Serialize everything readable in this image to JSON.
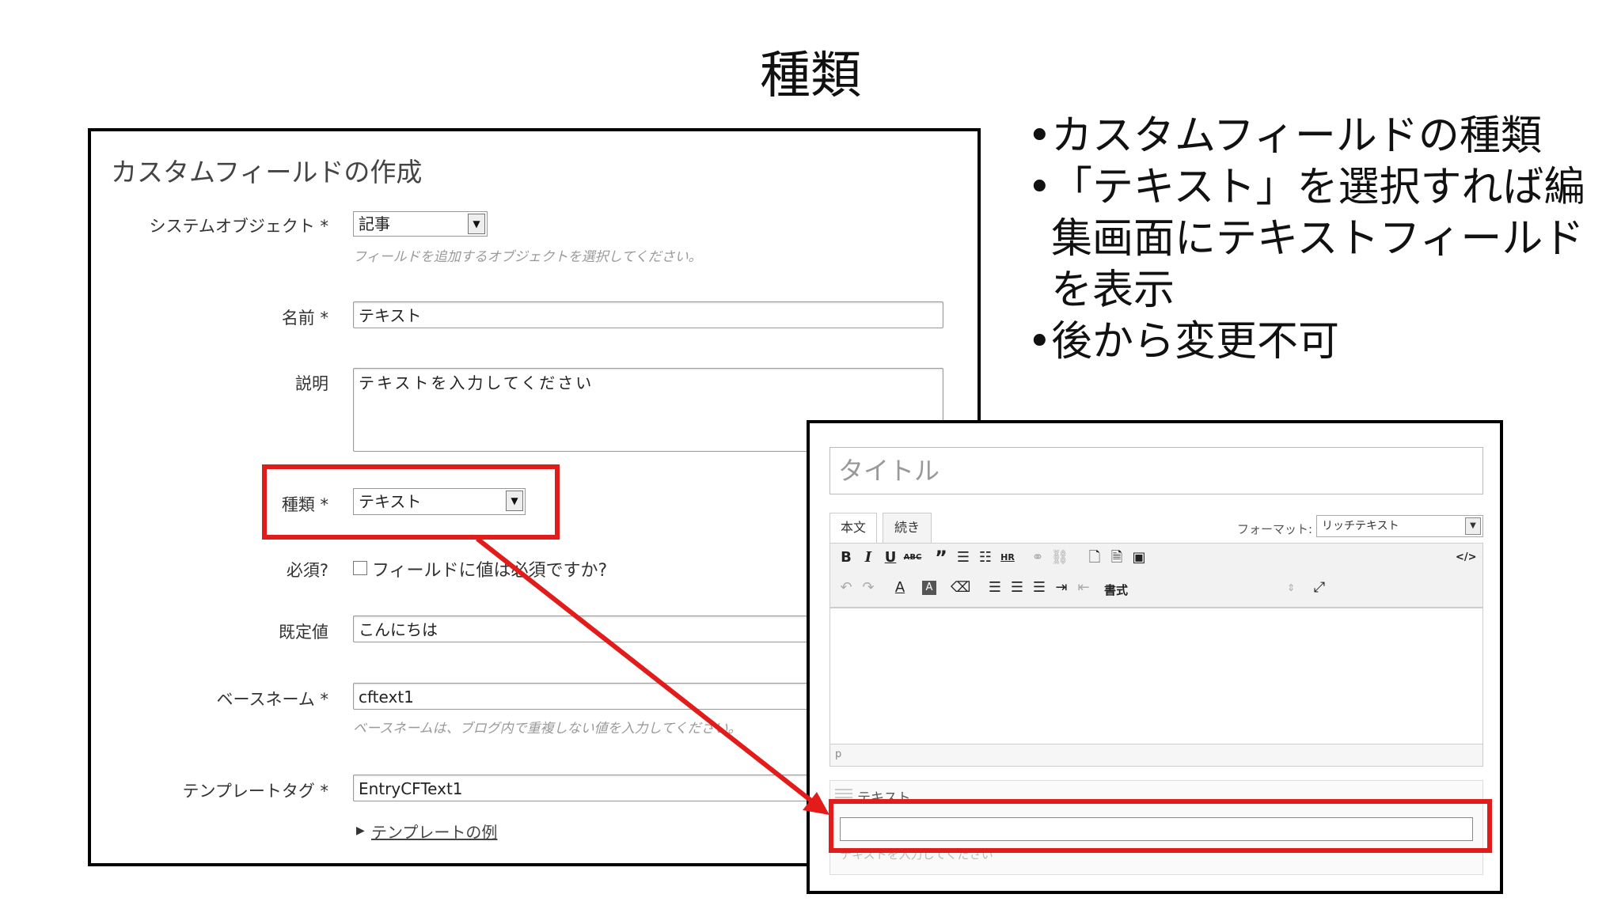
{
  "slide": {
    "title": "種類",
    "bullets": [
      "カスタムフィールドの種類",
      "「テキスト」を選択すれば編集画面にテキストフィールドを表示",
      "後から変更不可"
    ]
  },
  "create_form": {
    "heading": "カスタムフィールドの作成",
    "system_object": {
      "label": "システムオブジェクト *",
      "value": "記事",
      "hint": "フィールドを追加するオブジェクトを選択してください。"
    },
    "name": {
      "label": "名前 *",
      "value": "テキスト"
    },
    "description": {
      "label": "説明",
      "value": "テキストを入力してください"
    },
    "type": {
      "label": "種類 *",
      "value": "テキスト"
    },
    "required": {
      "label": "必須?",
      "checkbox_label": "フィールドに値は必須ですか?",
      "checked": false
    },
    "default": {
      "label": "既定値",
      "value": "こんにちは"
    },
    "basename": {
      "label": "ベースネーム *",
      "value": "cftext1",
      "hint": "ベースネームは、ブログ内で重複しない値を入力してください。"
    },
    "template_tag": {
      "label": "テンプレートタグ *",
      "value": "EntryCFText1",
      "link": "テンプレートの例"
    }
  },
  "entry_editor": {
    "title_placeholder": "タイトル",
    "tabs": [
      "本文",
      "続き"
    ],
    "format_label": "フォーマット:",
    "format_value": "リッチテキスト",
    "format_select_label": "書式",
    "status_path": "p",
    "custom_field_label": "テキスト",
    "custom_field_hint": "テキストを入力してください"
  },
  "colors": {
    "highlight": "#e21b1b"
  },
  "icons": [
    "bold-icon",
    "italic-icon",
    "underline-icon",
    "strikethrough-icon",
    "blockquote-icon",
    "bullet-list-icon",
    "numbered-list-icon",
    "hr-icon",
    "link-icon",
    "unlink-icon",
    "insert-file-icon",
    "insert-asset-icon",
    "insert-image-icon",
    "source-code-icon",
    "undo-icon",
    "redo-icon",
    "text-color-icon",
    "background-color-icon",
    "eraser-icon",
    "align-left-icon",
    "align-center-icon",
    "align-right-icon",
    "indent-icon",
    "outdent-icon",
    "fullscreen-icon"
  ]
}
